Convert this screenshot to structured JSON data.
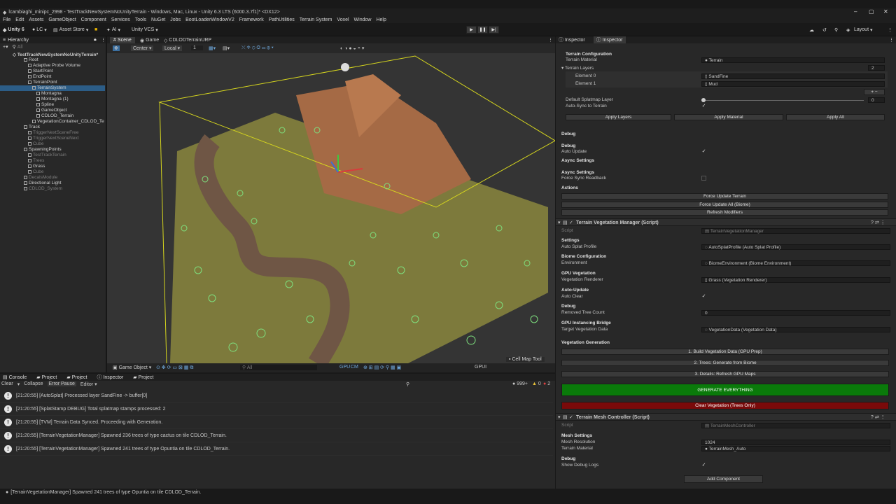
{
  "window": {
    "title": "lcambiaghi_minipc_2998 - TestTrackNewSystemNoUnityTerrain - Windows, Mac, Linux - Unity 6.3 LTS (6000.3.7f1)* <DX12>"
  },
  "menu": [
    "File",
    "Edit",
    "Assets",
    "GameObject",
    "Component",
    "Services",
    "Tools",
    "NuGet",
    "Jobs",
    "BootLoaderWindowV2",
    "Framework",
    "PathUtilities",
    "Terrain System",
    "Voxel",
    "Window",
    "Help"
  ],
  "toolbar": {
    "unity": "Unity 6",
    "account": "LC",
    "asset_store": "Asset Store",
    "ai": "AI",
    "vcs": "Unity VCS",
    "layout": "Layout"
  },
  "hierarchy": {
    "tab": "Hierarchy",
    "search_placeholder": "All",
    "scene": "TestTrackNewSystemNoUnityTerrain*",
    "items": [
      {
        "label": "Root"
      },
      {
        "label": "Adaptive Probe Volume"
      },
      {
        "label": "StartPoint"
      },
      {
        "label": "EndPoint"
      },
      {
        "label": "TerrainPoint"
      },
      {
        "label": "TerrainSystem"
      },
      {
        "label": "Montagna"
      },
      {
        "label": "Montagna (1)"
      },
      {
        "label": "Spline"
      },
      {
        "label": "GameObject"
      },
      {
        "label": "CDLOD_Terrain"
      },
      {
        "label": "VegetationContainer_CDLOD_Te"
      },
      {
        "label": "Track"
      },
      {
        "label": "TriggerNextSceneFree"
      },
      {
        "label": "TriggerNextSceneNext"
      },
      {
        "label": "Cube"
      },
      {
        "label": "SpawningPoints"
      },
      {
        "label": "TestTrackTerrain"
      },
      {
        "label": "Trees"
      },
      {
        "label": "Grass"
      },
      {
        "label": "Cube"
      },
      {
        "label": "DecalsModule"
      },
      {
        "label": "Directional Light"
      },
      {
        "label": "CDLOD_System"
      }
    ]
  },
  "scene": {
    "tabs": [
      "Scene",
      "Game",
      "CDLODTerrainURP"
    ],
    "pivot": "Center",
    "space": "Local",
    "snap": "1",
    "bottom_dropdown": "Game Object",
    "search_placeholder": "All",
    "gpu_label": "GPU",
    "cm_label": "CM",
    "gpu_ui": "GPUI",
    "cell_map_tool": "Cell Map Tool"
  },
  "console": {
    "tabs": [
      "Console",
      "Project",
      "Project",
      "Inspector",
      "Project"
    ],
    "toolbar": {
      "clear": "Clear",
      "collapse": "Collapse",
      "error_pause": "Error Pause",
      "editor": "Editor"
    },
    "counts": {
      "info": "999+",
      "warn": "0",
      "error": "2"
    },
    "logs": [
      "[21:20:55] [AutoSplat] Processed layer SandFine -> buffer[0]",
      "[21:20:55] [SplatStamp DEBUG] Total splatmap stamps processed: 2",
      "[21:20:55] [TVM] Terrain Data Synced. Proceeding with Generation.",
      "[21:20:55] [TerrainVegetationManager] Spawned 236 trees of type cactus on tile CDLOD_Terrain.",
      "[21:20:55] [TerrainVegetationManager] Spawned 241 trees of type Opuntia on tile CDLOD_Terrain."
    ]
  },
  "status": "[TerrainVegetationManager] Spawned 241 trees of type Opuntia on tile CDLOD_Terrain.",
  "inspector": {
    "tabs": [
      "Inspector",
      "Inspector"
    ],
    "terrain_config": {
      "header": "Terrain Configuration",
      "material_label": "Terrain Material",
      "material_value": "Terrain",
      "layers_label": "Terrain Layers",
      "layers_count": "2",
      "element0": "Element 0",
      "element0_value": "SandFine",
      "element1": "Element 1",
      "element1_value": "Mud",
      "default_layer_label": "Default Splatmap Layer",
      "default_layer_value": "0",
      "autosync_label": "Auto-Sync to Terrain"
    },
    "buttons": {
      "apply_layers": "Apply Layers",
      "apply_material": "Apply Material",
      "apply_all": "Apply All"
    },
    "debug": {
      "section": "Debug",
      "header": "Debug",
      "auto_update": "Auto Update"
    },
    "async": {
      "section": "Async Settings",
      "header": "Async Settings",
      "force_sync": "Force Sync Readback"
    },
    "actions": {
      "header": "Actions",
      "force_terrain": "Force Update Terrain",
      "force_all": "Force Update All (Biome)",
      "refresh": "Refresh Modifiers"
    },
    "tvm": {
      "title": "Terrain Vegetation Manager (Script)",
      "script_label": "Script",
      "script_value": "TerrainVegetationManager",
      "settings": "Settings",
      "auto_splat": "Auto Splat Profile",
      "auto_splat_value": "AutoSplatProfile (Auto Splat Profile)",
      "biome": "Biome Configuration",
      "environment": "Environment",
      "environment_value": "BiomeEnvironment (Biome Environment)",
      "gpu": "GPU Vegetation",
      "veg_renderer": "Vegetation Renderer",
      "veg_renderer_value": "Grass (Vegetation Renderer)",
      "autoupdate": "Auto-Update",
      "auto_clear": "Auto Clear",
      "debug": "Debug",
      "removed": "Removed Tree Count",
      "removed_value": "0",
      "bridge": "GPU Instancing Bridge",
      "target": "Target Vegetation Data",
      "target_value": "VegetationData (Vegetation Data)",
      "generation": "Vegetation Generation",
      "build": "1. Build Vegetation Data (GPU Prep)",
      "trees": "2. Trees: Generate from Biome",
      "details": "3. Details: Refresh GPU Maps",
      "generate": "GENERATE EVERYTHING",
      "clear": "Clear Vegetation (Trees Only)"
    },
    "tmc": {
      "title": "Terrain Mesh Controller (Script)",
      "script_label": "Script",
      "script_value": "TerrainMeshController",
      "mesh_settings": "Mesh Settings",
      "resolution": "Mesh Resolution",
      "resolution_value": "1024",
      "material": "Terrain Material",
      "material_value": "TerrainMesh_Auto",
      "debug": "Debug",
      "show_debug": "Show Debug Logs"
    },
    "add_component": "Add Component"
  },
  "colors": {
    "generate": "#0a7a0a",
    "clear": "#7a0a0a",
    "selection": "#2c5d87",
    "terrain": "#7f7a3a"
  }
}
